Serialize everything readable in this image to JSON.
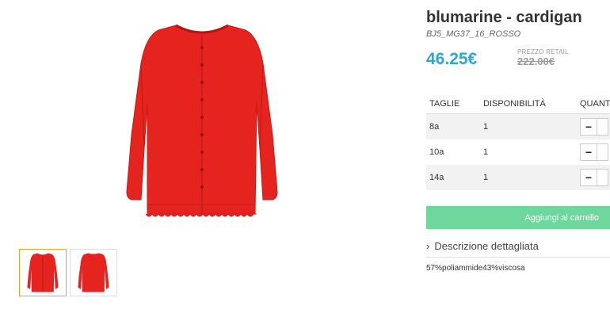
{
  "product": {
    "title": "blumarine - cardigan",
    "sku": "BJ5_MG37_16_ROSSO",
    "price": "46.25€",
    "retail_label": "PREZZO RETAIL",
    "retail_price": "222.00€",
    "color": "#e5231f"
  },
  "table": {
    "headers": [
      "TAGLIE",
      "DISPONIBILITÀ",
      "QUANT"
    ],
    "rows": [
      {
        "size": "8a",
        "availability": "1",
        "minus": "−"
      },
      {
        "size": "10a",
        "availability": "1",
        "minus": "−"
      },
      {
        "size": "14a",
        "availability": "1",
        "minus": "−"
      }
    ]
  },
  "actions": {
    "add_to_cart": "Aggiungi al carrello"
  },
  "description": {
    "toggle_icon": "›",
    "toggle_label": "Descrizione dettagliata",
    "composition": "57%poliammide43%viscosa"
  },
  "colors": {
    "accent_price": "#2ba6d6",
    "add_button": "#6ed89c"
  }
}
